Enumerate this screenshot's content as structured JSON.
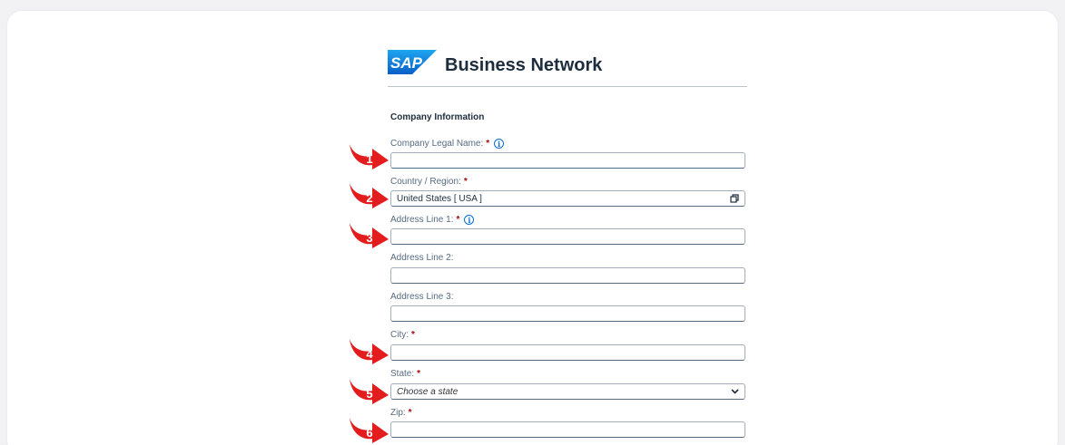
{
  "header": {
    "logo_text": "SAP",
    "brand": "Business Network"
  },
  "section_title": "Company Information",
  "required_mark": "*",
  "fields": {
    "legal_name": {
      "label": "Company Legal Name:",
      "value": "",
      "info_glyph": "i"
    },
    "country": {
      "label": "Country / Region:",
      "value": "United States [ USA ]",
      "icon": "value-help-icon"
    },
    "address1": {
      "label": "Address Line 1:",
      "value": "",
      "info_glyph": "i"
    },
    "address2": {
      "label": "Address Line 2:",
      "value": ""
    },
    "address3": {
      "label": "Address Line 3:",
      "value": ""
    },
    "city": {
      "label": "City:",
      "value": ""
    },
    "state": {
      "label": "State:",
      "placeholder": "Choose a state",
      "icon": "chevron-down-icon"
    },
    "zip": {
      "label": "Zip:",
      "value": ""
    }
  },
  "markers": [
    "1",
    "2",
    "3",
    "4",
    "5",
    "6"
  ],
  "colors": {
    "marker": "#e31d1d",
    "required": "#aa0808",
    "link": "#0a6ed1",
    "logo_blue": "#1275d3"
  }
}
